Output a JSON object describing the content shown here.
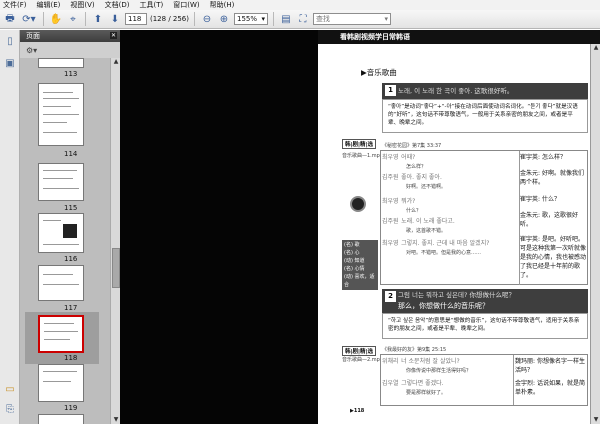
{
  "menu": [
    "文件(F)",
    "编辑(E)",
    "视图(V)",
    "文档(D)",
    "工具(T)",
    "窗口(W)",
    "帮助(H)"
  ],
  "toolbar": {
    "page_current": "118",
    "page_total": "(128 / 256)",
    "zoom": "155%",
    "search_placeholder": "查找"
  },
  "panel": {
    "title": "页面"
  },
  "thumbnails": [
    {
      "label": "113"
    },
    {
      "label": "114"
    },
    {
      "label": "115"
    },
    {
      "label": "116"
    },
    {
      "label": "117"
    },
    {
      "label": "118"
    },
    {
      "label": "119"
    }
  ],
  "page": {
    "banner": "看韩剧视频学日常韩语",
    "section": "▶音乐歌曲",
    "ex1": {
      "num": "1",
      "title": "노래, 이 노래 한 곡이 좋아. 这歌很好听。",
      "explain": "“좋아”是动词“좋다”+“-아”接在动词后面使动词名词化。“듣기 좋다”就是汉语的“好听”，这句话不带尊敬语气，一般用于关系亲密的朋友之间，或者是平辈、晚辈之间。",
      "badge": "韩|剧|精|选",
      "source": "《秘密花园》第7集 33:37",
      "track": "音乐歌曲—1.mp3",
      "left": [
        {
          "speaker": "최우영",
          "kr": "어때?",
          "cn": "怎么样？"
        },
        {
          "speaker": "김주원",
          "kr": "좋아. 좋지 좋아.",
          "cn": "好啊。还不错啊。"
        },
        {
          "speaker": "최우영",
          "kr": "뭐가?",
          "cn": "什么？"
        },
        {
          "speaker": "김주원",
          "kr": "노래. 이 노래 좋다고.",
          "cn": "歌，这首歌不错。"
        },
        {
          "speaker": "최우영",
          "kr": "그렇지. 좋지. 근데 내 마음 알겠지?",
          "cn": "对吧。不错吧。但是我的心意……"
        }
      ],
      "right": [
        {
          "speaker": "崔宇英:",
          "text": "怎么样？"
        },
        {
          "speaker": "金朱元:",
          "text": "好啊。就像我们两个样。"
        },
        {
          "speaker": "崔宇英:",
          "text": "什么？"
        },
        {
          "speaker": "金朱元:",
          "text": "歌，这歌很好听。"
        },
        {
          "speaker": "崔宇英:",
          "text": "是吧。好听吧。可是这种我第一次听就像是我的心情，我也被感动了我已经是十年前的歌了。"
        }
      ],
      "vocab": [
        "(名) 歌",
        "(名) 心",
        "(动) 知道",
        "(名) 心情",
        "(动) 喜欢，适合"
      ]
    },
    "ex2": {
      "num": "2",
      "title": "그럼 너는 뭐하고 싶은데? 你想做什么呢？",
      "subtitle": "那么，你想做什么的音乐呢？",
      "explain": "“하고 싶은 음악”的意思是“想做的音乐”，这句话不带尊敬语气，适用于关系亲密的朋友之间，或者是平辈、晚辈之间。",
      "badge": "韩|剧|精|选",
      "source": "《我最好的友》第9集 25:15",
      "track": "音乐歌曲—2.mp3",
      "left": [
        {
          "speaker": "위채리",
          "kr": "너 소문처럼 잘 살았니?",
          "cn": "你像传说中那样生活得好吗？"
        },
        {
          "speaker": "김우열",
          "kr": "그렇다면 좋겠다.",
          "cn": "要是那样就好了。"
        }
      ],
      "right": [
        {
          "speaker": "魏玛丽:",
          "text": "你想像名字一样生活吗？"
        },
        {
          "speaker": "金宇烈:",
          "text": "话说如果，就是简单朴素。"
        }
      ]
    },
    "page_num": "▶118"
  }
}
